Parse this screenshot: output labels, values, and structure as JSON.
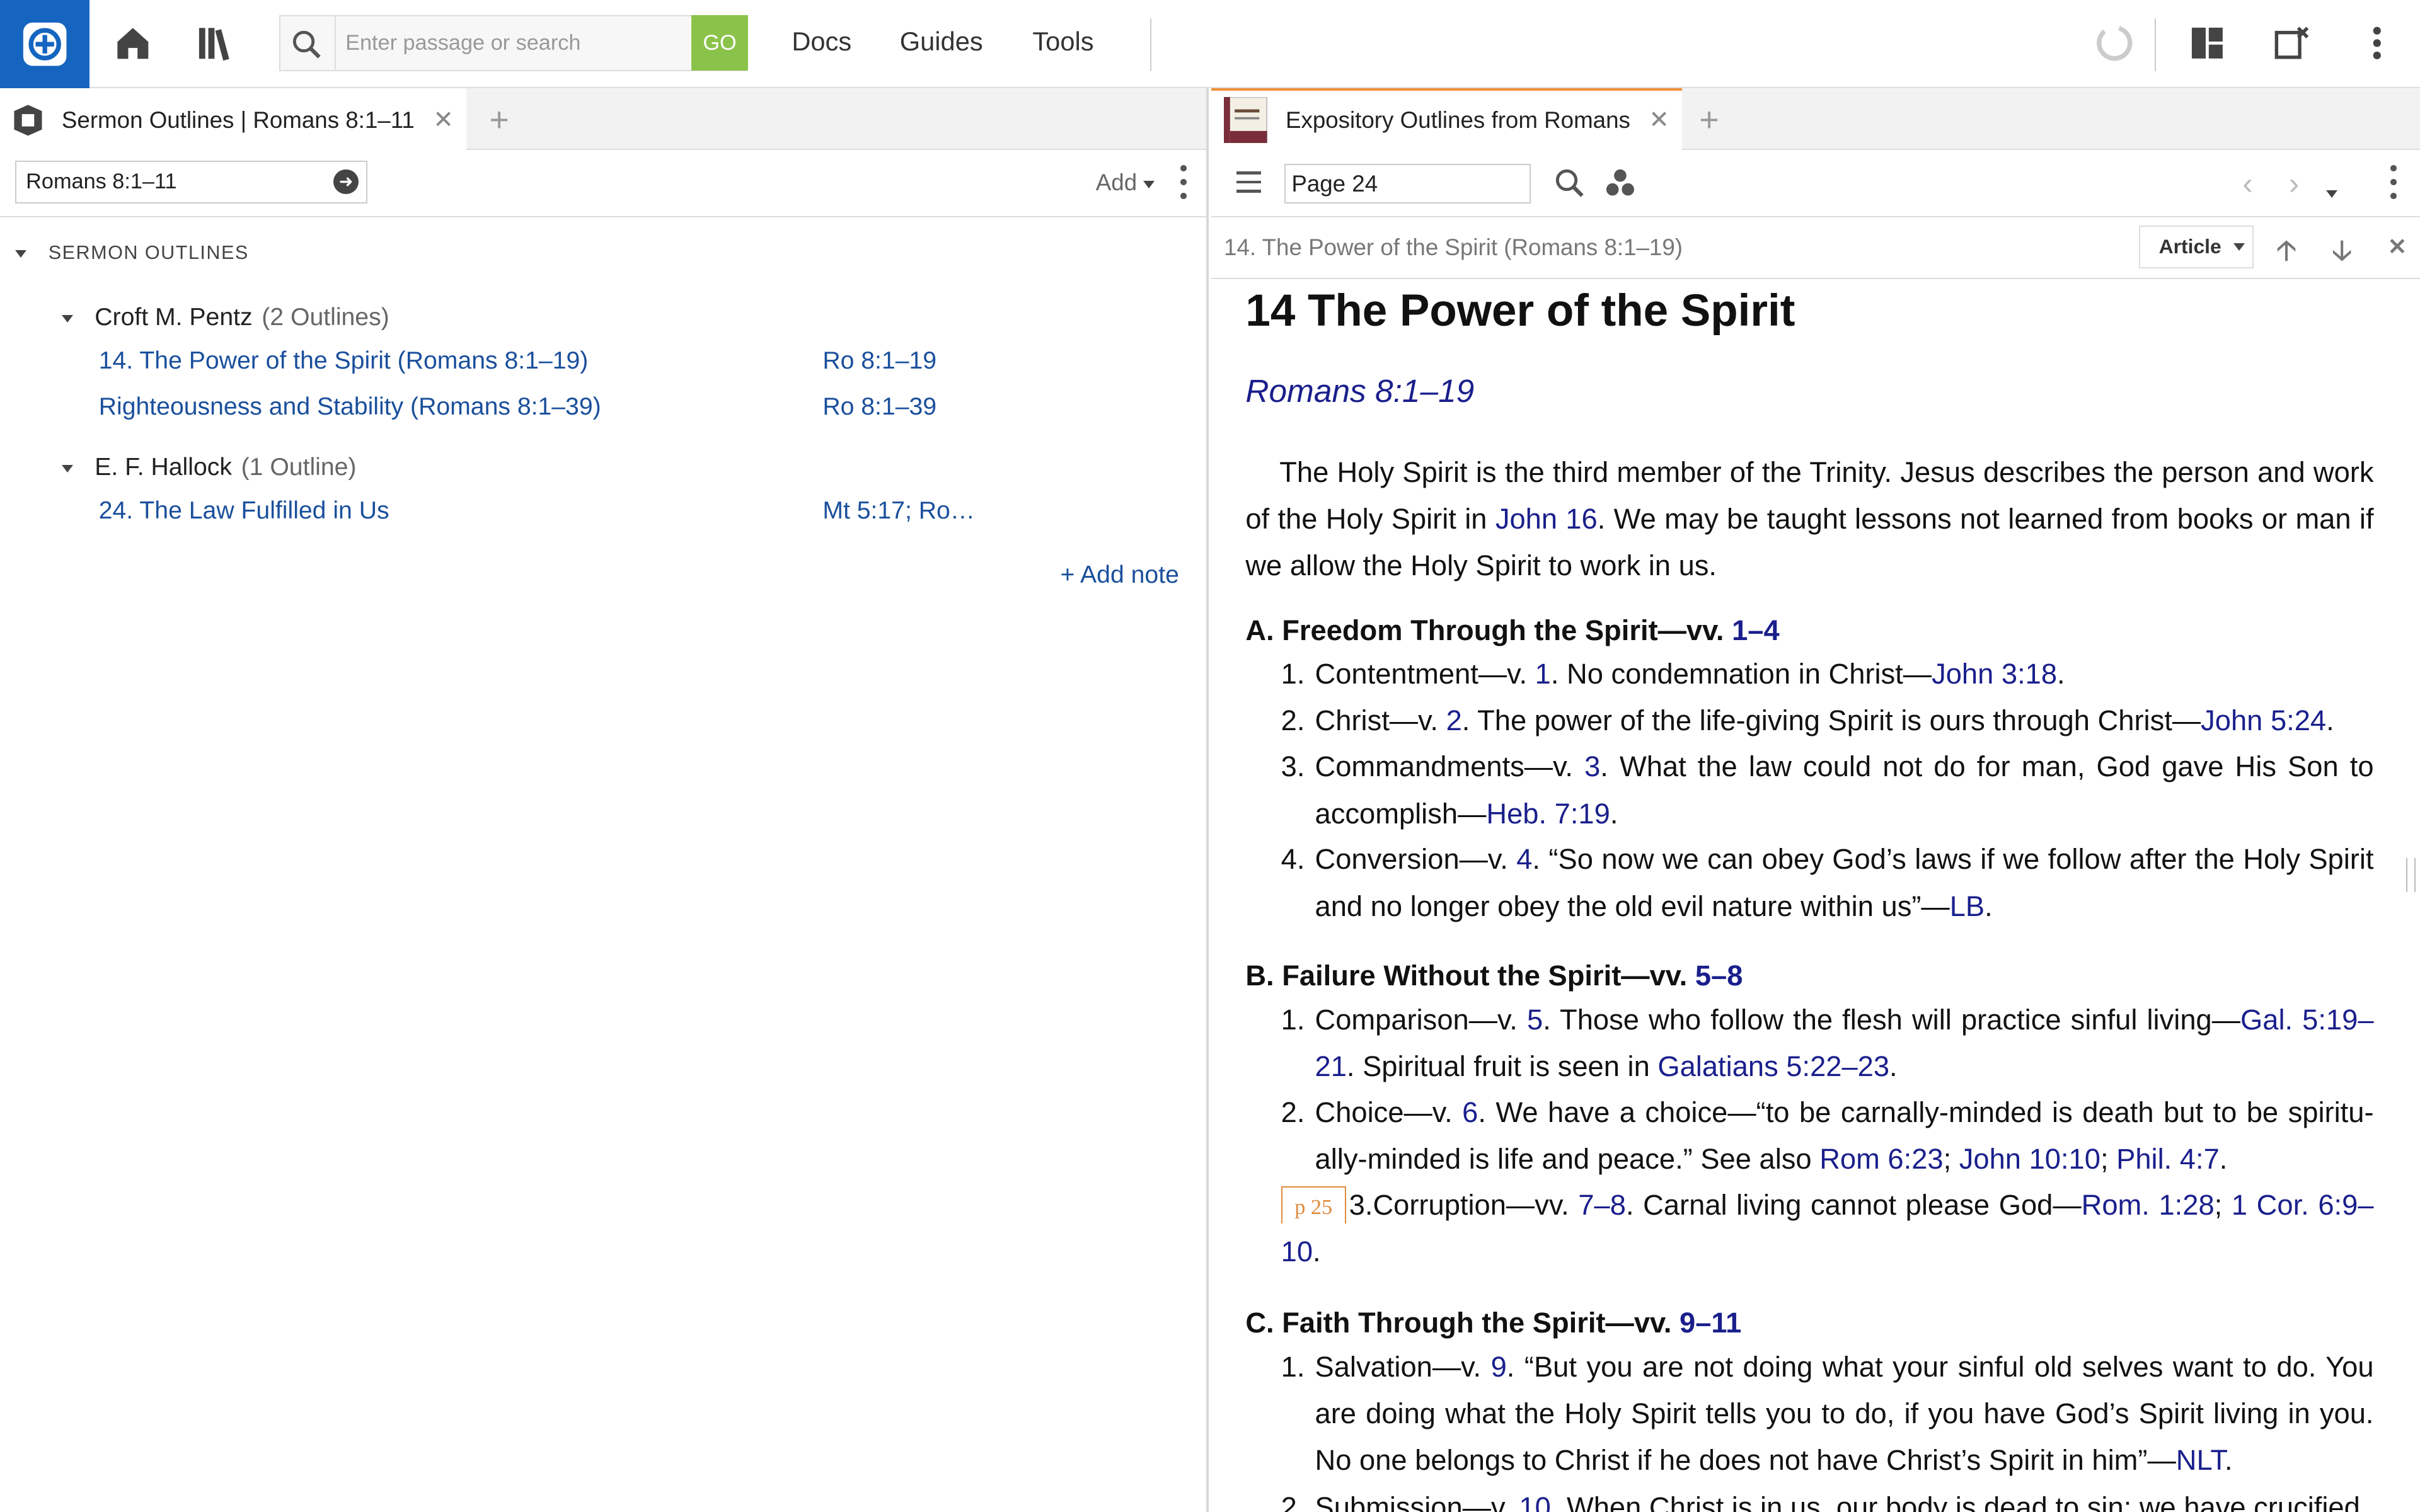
{
  "topbar": {
    "search_placeholder": "Enter passage or search",
    "go_label": "GO",
    "nav": [
      "Docs",
      "Guides",
      "Tools"
    ]
  },
  "left": {
    "tab_label": "Sermon Outlines | Romans 8:1–11",
    "reference_value": "Romans 8:1–11",
    "add_label": "Add",
    "section_header": "SERMON OUTLINES",
    "authors": [
      {
        "name": "Croft M. Pentz",
        "count": "(2 Outlines)",
        "outlines": [
          {
            "title": "14. The Power of the Spirit (Romans 8:1–19)",
            "ref": "Ro 8:1–19"
          },
          {
            "title": "Righteousness and Stability (Romans 8:1–39)",
            "ref": "Ro 8:1–39"
          }
        ]
      },
      {
        "name": "E. F. Hallock",
        "count": "(1 Outline)",
        "outlines": [
          {
            "title": "24. The Law Fulfilled in Us",
            "ref": "Mt 5:17; Ro…"
          }
        ]
      }
    ],
    "add_note": "+ Add note"
  },
  "right": {
    "tab_label": "Expository Outlines from Romans",
    "page_value": "Page 24",
    "breadcrumb": "14. The Power of the Spirit (Romans 8:1–19)",
    "article_button": "Article",
    "article": {
      "title": "14 The Power of the Spirit",
      "ref": "Romans 8:1–19",
      "intro": {
        "a": "The Holy Spirit is the third member of the Trinity. Jesus describes the person and work of the Holy Spirit in ",
        "link": "John 16",
        "b": ". We may be taught lessons not learned from books or man if we allow the Holy Spirit to work in us."
      },
      "sectionA": {
        "text": "A. Freedom Through the Spirit—vv. ",
        "ref": "1–4"
      },
      "a1": {
        "num": "1.",
        "a": "Contentment—v. ",
        "v": "1",
        "b": ". No condemnation in Christ—",
        "link": "John 3:18",
        "c": "."
      },
      "a2": {
        "num": "2.",
        "a": "Christ—v. ",
        "v": "2",
        "b": ". The power of the life-giving Spirit is ours through Christ—",
        "link": "John 5:24",
        "c": "."
      },
      "a3": {
        "num": "3.",
        "a": "Commandments—v. ",
        "v": "3",
        "b": ". What the law could not do for man, God gave His Son to accomplish—",
        "link": "Heb. 7:19",
        "c": "."
      },
      "a4": {
        "num": "4.",
        "a": "Conversion—v. ",
        "v": "4",
        "b": ". “So now we can obey God’s laws if we follow after the Holy Spirit and no longer obey the old evil nature within us”—",
        "link": "LB",
        "c": "."
      },
      "sectionB": {
        "text": "B. Failure Without the Spirit—vv. ",
        "ref": "5–8"
      },
      "b1": {
        "num": "1.",
        "a": "Comparison—v. ",
        "v": "5",
        "b": ". Those who follow the flesh will practice sinful living—",
        "link": "Gal. 5:19–21",
        "c": ". Spiritual fruit is seen in ",
        "link2": "Galatians 5:22–23",
        "d": "."
      },
      "b2": {
        "num": "2.",
        "a": "Choice—v. ",
        "v": "6",
        "b": ". We have a choice—“to be carnally-minded is death but to be spiritu­ally-minded is life and peace.” See also ",
        "link": "Rom 6:23",
        "s1": "; ",
        "link2": "John 10:10",
        "s2": "; ",
        "link3": "Phil. 4:7",
        "c": "."
      },
      "b3": {
        "pmark": "p 25",
        "num": "3.",
        "a": "Corruption—vv. ",
        "v": "7–8",
        "b": ". Carnal living cannot please God—",
        "link": "Rom. 1:28",
        "s1": "; ",
        "link2": "1 Cor. 6:9–10",
        "c": "."
      },
      "sectionC": {
        "text": "C. Faith Through the Spirit—vv. ",
        "ref": "9–11"
      },
      "c1": {
        "num": "1.",
        "a": "Salvation—v. ",
        "v": "9",
        "b": ". “But you are not doing what your sinful old selves want to do. You are doing what the Holy Spirit tells you to do, if you have God’s Spirit living in you. No one belongs to Christ if he does not have Christ’s Spirit in him”—",
        "link": "NLT",
        "c": "."
      },
      "c2": {
        "num": "2.",
        "a": "Submission—v. ",
        "v": "10",
        "b": ". When Christ is in us, our body is dead to sin; we have crucified"
      }
    }
  }
}
